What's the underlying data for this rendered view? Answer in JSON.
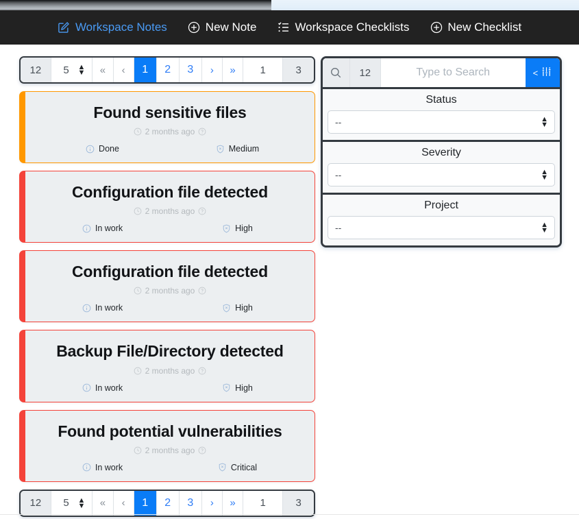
{
  "navbar": {
    "items": [
      {
        "label": "Workspace Notes",
        "icon": "edit-square-icon",
        "active": true
      },
      {
        "label": "New Note",
        "icon": "plus-circle-icon",
        "active": false
      },
      {
        "label": "Workspace Checklists",
        "icon": "list-check-icon",
        "active": false
      },
      {
        "label": "New Checklist",
        "icon": "plus-circle-icon",
        "active": false
      }
    ]
  },
  "pager": {
    "total_count": "12",
    "page_size": "5",
    "first_label": "«",
    "prev_label": "‹",
    "pages": [
      "1",
      "2",
      "3"
    ],
    "current_page_index": 0,
    "next_label": "›",
    "last_label": "»",
    "current_page": "1",
    "total_pages": "3"
  },
  "notes": [
    {
      "title": "Found sensitive files",
      "time": "2 months ago",
      "status": "Done",
      "severity": "Medium",
      "accent": "#FF9800"
    },
    {
      "title": "Configuration file detected",
      "time": "2 months ago",
      "status": "In work",
      "severity": "High",
      "accent": "#F4433A"
    },
    {
      "title": "Configuration file detected",
      "time": "2 months ago",
      "status": "In work",
      "severity": "High",
      "accent": "#F4433A"
    },
    {
      "title": "Backup File/Directory detected",
      "time": "2 months ago",
      "status": "In work",
      "severity": "High",
      "accent": "#F4433A"
    },
    {
      "title": "Found potential vulnerabilities",
      "time": "2 months ago",
      "status": "In work",
      "severity": "Critical",
      "accent": "#F4433A"
    }
  ],
  "search": {
    "icon": "magnifier-icon",
    "count": "12",
    "placeholder": "Type to Search",
    "value": "",
    "filter_button_label": "<",
    "filter_button_icon": "sliders-icon",
    "accent": "#0A7CF7"
  },
  "filters": [
    {
      "label": "Status",
      "value": "--"
    },
    {
      "label": "Severity",
      "value": "--"
    },
    {
      "label": "Project",
      "value": "--"
    }
  ]
}
